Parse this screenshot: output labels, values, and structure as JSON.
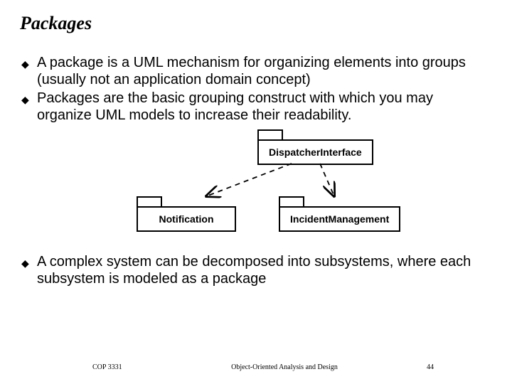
{
  "title": "Packages",
  "bullets": [
    "A package is a UML mechanism for organizing elements into groups  (usually not an application domain concept)",
    "Packages are the basic grouping construct with which you may organize UML models to increase their readability."
  ],
  "packages": {
    "top": "DispatcherInterface",
    "left": "Notification",
    "right": "IncidentManagement"
  },
  "bullets2": [
    "A complex system can be decomposed into subsystems, where each subsystem is modeled as a package"
  ],
  "footer": {
    "left": "COP 3331",
    "center": "Object-Oriented Analysis and Design",
    "right": "44"
  }
}
